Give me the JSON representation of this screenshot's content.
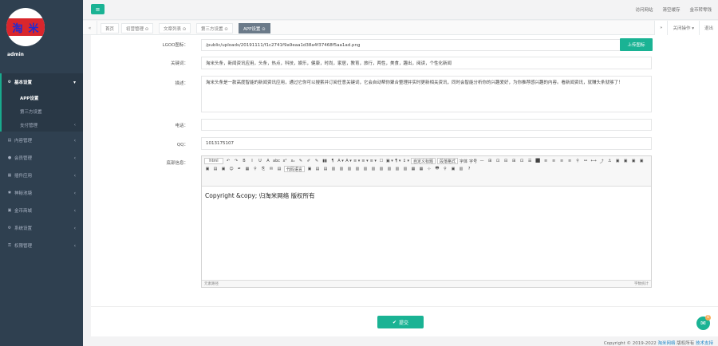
{
  "logo": {
    "left_char": "淘",
    "right_char": "米"
  },
  "user": {
    "name": "admin"
  },
  "sidebar": {
    "items": [
      {
        "label": "基本设置",
        "icon": "gear-icon"
      },
      {
        "label": "内容管理",
        "icon": "folder-icon"
      },
      {
        "label": "会员管理",
        "icon": "user-icon"
      },
      {
        "label": "插件应用",
        "icon": "grid-icon"
      },
      {
        "label": "神秘池塘",
        "icon": "bug-icon"
      },
      {
        "label": "金币商城",
        "icon": "cart-icon"
      },
      {
        "label": "系统设置",
        "icon": "cog-icon"
      },
      {
        "label": "权限管理",
        "icon": "key-icon"
      }
    ],
    "subitems": [
      {
        "label": "APP设置"
      },
      {
        "label": "第三方设置"
      },
      {
        "label": "支付管理"
      }
    ]
  },
  "topbar": {
    "links": [
      "访问网站",
      "清空缓存",
      "金币转零钱"
    ]
  },
  "tabs": {
    "items": [
      "首页",
      "初营管理 ⊙",
      "文章列表 ⊙",
      "第三方设置 ⊙",
      "APP设置 ⊙"
    ],
    "right": [
      "关闭操作 ▾",
      "退出"
    ]
  },
  "form": {
    "logo_label": "LGOO图标：",
    "logo_value": "/public/uploads/20191111/f1c2741f9a9eaa1d38a4f37468f5aa1ad.png",
    "upload_label": "上传图标",
    "keywords_label": "关键词：",
    "keywords_value": "淘米头条，新闻资讯应用，头条，热点，科技，娱乐，健康，时尚，家居，教育，旅行，两性，美食，趣出，阅读，个性化新闻",
    "desc_label": "描述：",
    "desc_value": "淘米头条是一款高度智能的新闻资讯应用，通过它你可以搜索并订阅任意关键词，它会自动帮你聚合整理并实时更新相关资讯，同时会智能分析你的兴趣爱好，为你推荐感兴趣的内容。看新闻资讯，就赚头条就够了！",
    "phone_label": "电话：",
    "phone_value": "",
    "qq_label": "QQ：",
    "qq_value": "1013175107",
    "footer_label": "底部信息：",
    "editor_content": "Copyright &copy; 归淘米网络 版权所有",
    "editor_status_left": "元素路径",
    "editor_status_right": "字数统计",
    "submit_label": "提交"
  },
  "toolbar": {
    "row1": [
      "html",
      "↶",
      "↷",
      "B",
      "I",
      "U",
      "A",
      "abc",
      "x²",
      "x₂",
      "✎",
      "✐",
      "✎",
      "▮▮",
      "¶",
      "A ▾",
      "A ▾",
      "≡ ▾",
      "≡ ▾",
      "≡ ▾",
      "☐",
      "▣ ▾",
      "¶ ▾",
      "↕ ▾",
      "自定义标题",
      "段落格式",
      "字体",
      "字号",
      "—",
      "⊞",
      "⊡",
      "⊟",
      "⊞",
      "⊡",
      "☰",
      "⬛"
    ],
    "row2": [
      "≡",
      "≡",
      "≡",
      "≡",
      "⚲",
      "⚯",
      "⟷",
      "⤴",
      "⚓",
      "▣",
      "▣",
      "▣",
      "▣",
      "▣",
      "▤",
      "▣",
      "☺",
      "✒",
      "▦",
      "⚲",
      "⎘",
      "✉",
      "▤",
      "代码语言",
      "▣",
      "▤",
      "▤",
      "▥",
      "▥",
      "▥",
      "▥",
      "▥",
      "▥",
      "▥",
      "▥",
      "▥",
      "▥"
    ],
    "row3": [
      "▦",
      "▦",
      "⊹",
      "🖶",
      "⚲",
      "▣",
      "▥",
      "?"
    ]
  },
  "footer": {
    "text": "Copyright © 2019-2022",
    "company": "淘米网络",
    "rights": "版权所有",
    "support": "技术支持"
  },
  "chat": {
    "badge": "0"
  }
}
